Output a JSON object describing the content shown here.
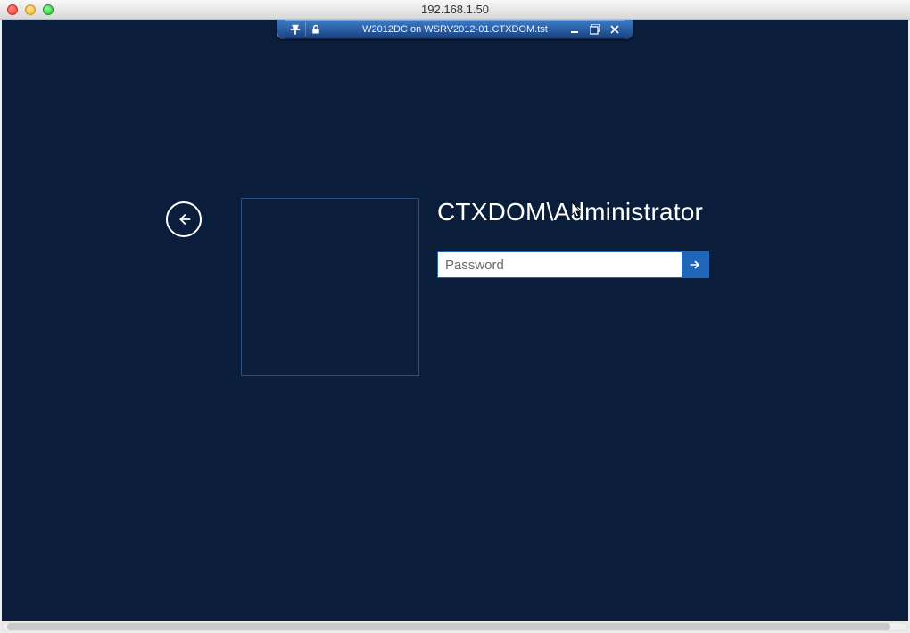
{
  "mac": {
    "title": "192.168.1.50"
  },
  "connection_bar": {
    "title": "W2012DC on WSRV2012-01.CTXDOM.tst",
    "icons": {
      "pin": "pin-icon",
      "lock": "lock-icon",
      "minimize": "minimize-icon",
      "restore": "restore-icon",
      "close": "close-icon"
    }
  },
  "login": {
    "username": "CTXDOM\\Administrator",
    "password_placeholder": "Password",
    "password_value": ""
  },
  "colors": {
    "background": "#0a1d3b",
    "accent": "#1f66b8"
  }
}
